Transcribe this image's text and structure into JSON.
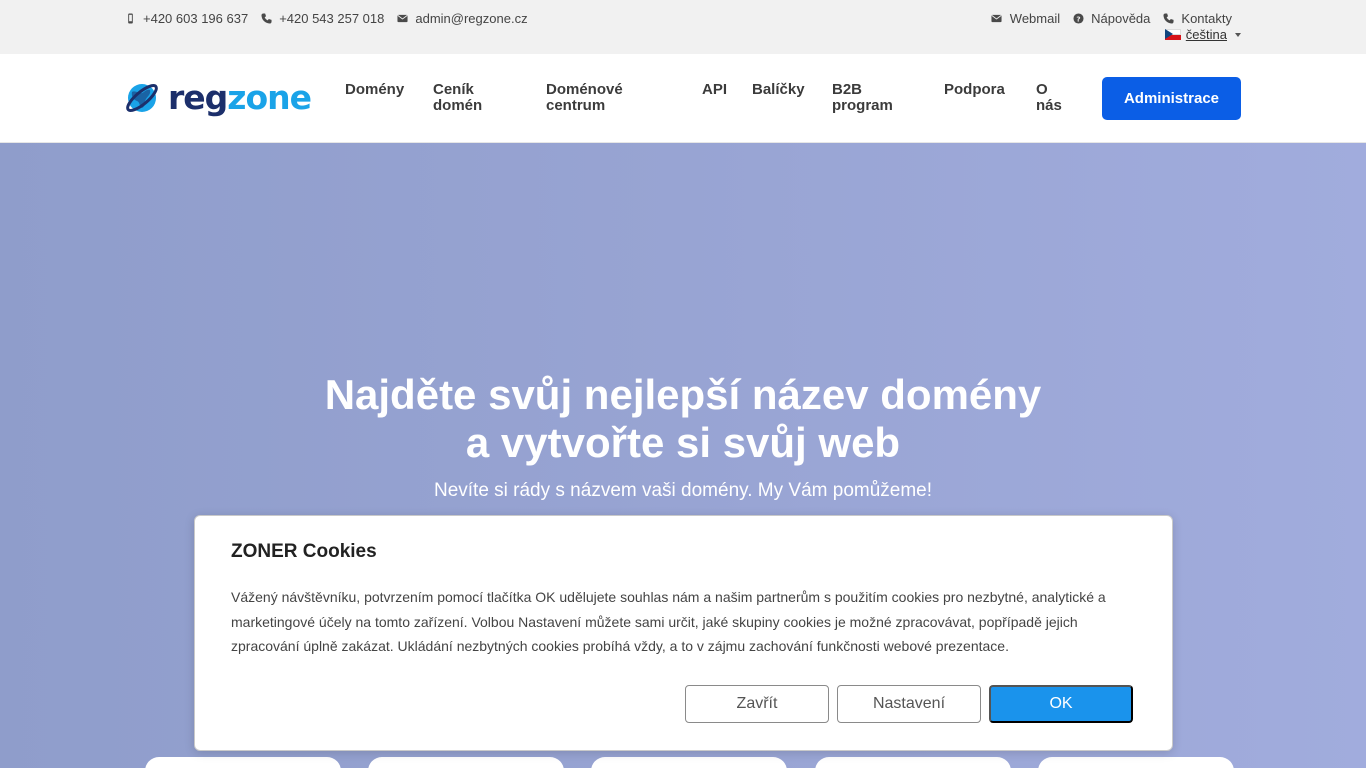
{
  "topbar": {
    "phone_mobile": "+420 603 196 637",
    "phone_landline": "+420 543 257 018",
    "email": "admin@regzone.cz",
    "webmail": "Webmail",
    "help": "Nápověda",
    "contacts": "Kontakty",
    "language": "čeština"
  },
  "logo": {
    "part1": "reg",
    "part2": "zone"
  },
  "nav": {
    "items": [
      {
        "line1": "Domény",
        "line2": ""
      },
      {
        "line1": "Ceník",
        "line2": "domén"
      },
      {
        "line1": "Doménové",
        "line2": "centrum"
      },
      {
        "line1": "API",
        "line2": ""
      },
      {
        "line1": "Balíčky",
        "line2": ""
      },
      {
        "line1": "B2B",
        "line2": "program"
      },
      {
        "line1": "Podpora",
        "line2": ""
      },
      {
        "line1": "O",
        "line2": "nás"
      }
    ],
    "admin_label": "Administrace"
  },
  "hero": {
    "title_line1": "Najděte svůj nejlepší název domény",
    "title_line2": "a vytvořte si svůj web",
    "subtitle": "Nevíte si rády s názvem vaši domény. My Vám pomůžeme!"
  },
  "cookie": {
    "title": "ZONER Cookies",
    "text": "Vážený návštěvníku, potvrzením pomocí tlačítka OK udělujete souhlas nám a našim partnerům s použitím cookies pro nezbytné, analytické a marketingové účely na tomto zařízení. Volbou Nastavení můžete sami určit, jaké skupiny cookies je možné zpracovávat, popřípadě jejich zpracování úplně zakázat. Ukládání nezbytných cookies probíhá vždy, a to v zájmu zachování funkčnosti webové prezentace.",
    "close_label": "Zavřít",
    "settings_label": "Nastavení",
    "ok_label": "OK"
  },
  "colors": {
    "brand_dark": "#1c2f6b",
    "brand_light": "#1aa3e8",
    "admin_button": "#0b5ee6",
    "ok_button": "#1a93ec"
  }
}
